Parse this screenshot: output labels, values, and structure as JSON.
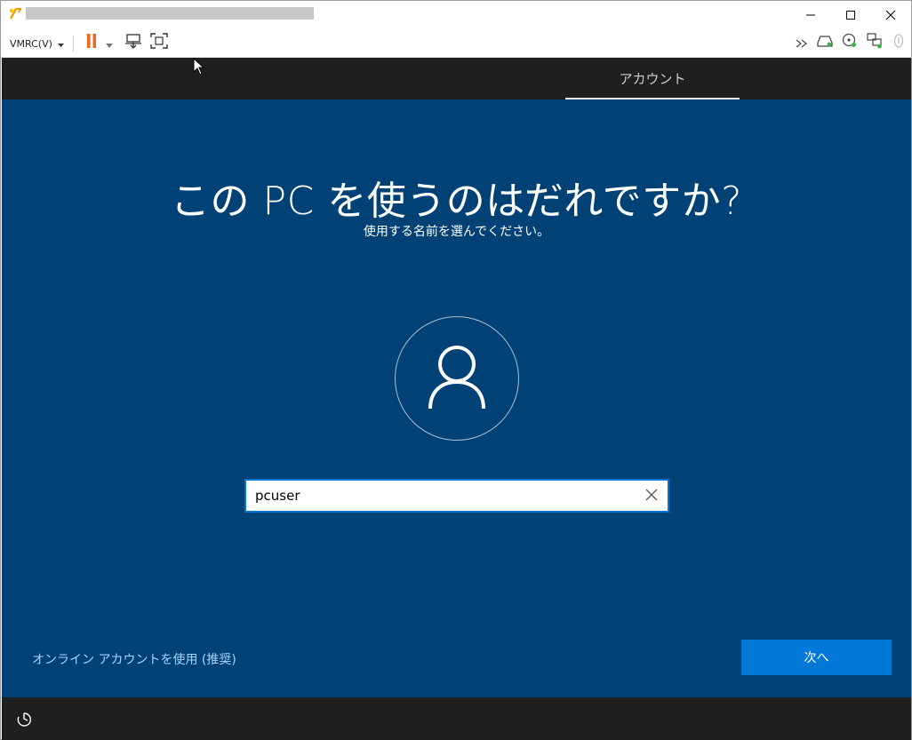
{
  "titlebar": {
    "app_icon": "vmrc-logo-icon",
    "buttons": {
      "minimize": "minimize-icon",
      "maximize": "maximize-icon",
      "close": "close-icon"
    }
  },
  "toolbar": {
    "vmrc_menu_label": "VMRC(V)",
    "left_icons": [
      "pause-icon",
      "chevron-down-icon",
      "send-keys-icon",
      "fullscreen-icon"
    ],
    "right_icons": [
      "double-chevron-right-icon",
      "hard-disk-icon",
      "cd-drive-icon",
      "network-adapter-icon",
      "usb-device-icon"
    ],
    "pause_color": "#f26522"
  },
  "oobe": {
    "tab_label": "アカウント",
    "heading": "この PC を使うのはだれですか?",
    "subheading": "使用する名前を選んでください。",
    "avatar_icon": "user-avatar-icon",
    "name_value": "pcuser",
    "online_account_link": "オンライン アカウントを使用 (推奨)",
    "next_button": "次へ",
    "ease_of_access_icon": "ease-of-access-icon",
    "colors": {
      "background": "#004275",
      "accent": "#0078d7",
      "link": "#a9d4ff",
      "frame": "#1f1f1f"
    }
  }
}
